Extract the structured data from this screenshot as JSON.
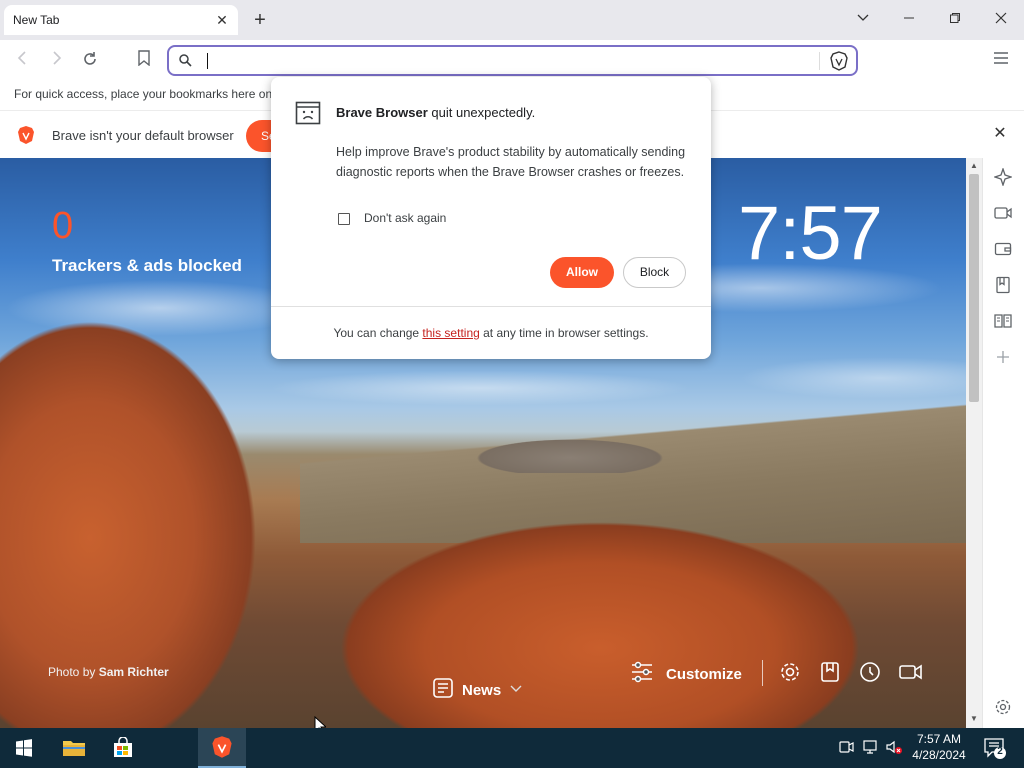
{
  "browser": {
    "tab_title": "New Tab",
    "bookmarks_hint": "For quick access, place your bookmarks here on the bookmarks bar.",
    "omnibox_value": ""
  },
  "infobar": {
    "message": "Brave isn't your default browser",
    "button_label": "Se"
  },
  "ntp": {
    "trackers_count": "0",
    "trackers_label": "Trackers & ads blocked",
    "clock": "7:57",
    "photo_credit_prefix": "Photo by ",
    "photo_credit_name": "Sam Richter",
    "news_label": "News",
    "customize_label": "Customize"
  },
  "dialog": {
    "title_bold": "Brave Browser",
    "title_rest": " quit unexpectedly.",
    "body": "Help improve Brave's product stability by automatically sending diagnostic reports when the Brave Browser crashes or freezes.",
    "checkbox_label": "Don't ask again",
    "allow_label": "Allow",
    "block_label": "Block",
    "footer_prefix": "You can change ",
    "footer_link": "this setting",
    "footer_suffix": " at any time in browser settings."
  },
  "taskbar": {
    "time": "7:57 AM",
    "date": "4/28/2024",
    "notification_count": "2"
  },
  "colors": {
    "brand_orange": "#fb542b",
    "omnibox_focus": "#7a6fc7",
    "taskbar_bg": "#0f2a3a"
  }
}
